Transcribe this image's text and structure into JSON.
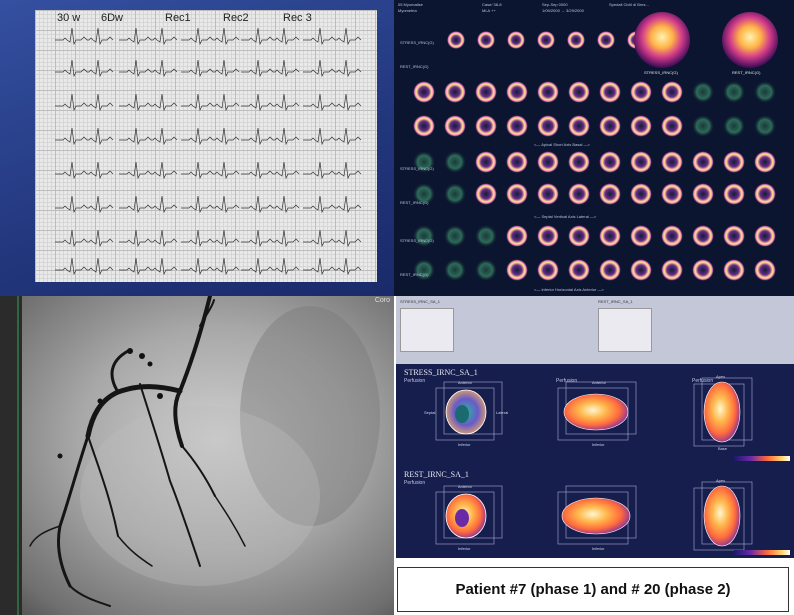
{
  "ecg": {
    "columns": [
      "30 w",
      "6Dw",
      "Rec1",
      "Rec2",
      "Rec 3"
    ]
  },
  "nuclear": {
    "header_left": "05 Myomatise",
    "header_sub": "Myometria",
    "header_c1": "Case/ 38-8",
    "header_c1b": "MLA ++",
    "header_c2": "Sep-Sep 0000",
    "header_c2b": "1/09/2000 → 3/29/2000",
    "header_c3": "Spedali Civili di Bres...",
    "polar_left": "STRESS_IRNC(G)",
    "polar_right": "REST_IRNC(G)",
    "row_labels": [
      "STRESS_IRNC(G)",
      "REST_IRNC(G)",
      "STRESS_IRNC(G)",
      "REST_IRNC(G)",
      "STRESS_IRNC(G)",
      "REST_IRNC(G)"
    ],
    "axis_sa": "<— Apical   Short Axis   Basal —>",
    "axis_vla": "<— Septal   Vertical Axis   Lateral —>",
    "axis_hla": "<— Inferior   Horizontal Axis   Anterior —>"
  },
  "angio": {
    "label": "Coro"
  },
  "three_d": {
    "top_left_title": "STRESS_IRNC_SA_1",
    "top_right_title": "REST_IRNC_SA_1",
    "stress_title": "STRESS_IRNC_SA_1",
    "rest_title": "REST_IRNC_SA_1",
    "perfusion": "Perfusion",
    "labels": {
      "anterior": "Anterior",
      "inferior": "Inferior",
      "septal": "Septal",
      "lateral": "Lateral",
      "apex": "Apex",
      "base": "Base"
    },
    "accent_colors": [
      "#ffb84d",
      "#ff6a3d",
      "#e8e8ff",
      "#2bb3a0"
    ]
  },
  "caption": {
    "text": "Patient #7 (phase 1) and # 20 (phase 2)"
  }
}
